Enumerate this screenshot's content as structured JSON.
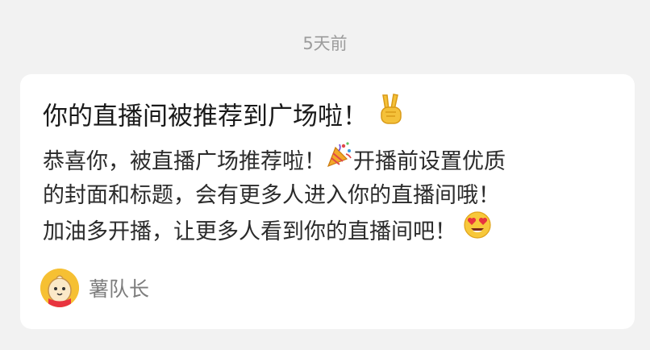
{
  "timestamp": "5天前",
  "card": {
    "title": "你的直播间被推荐到广场啦！",
    "title_emoji": "victory-hand-icon",
    "body": {
      "line1_a": "恭喜你，被直播广场推荐啦！",
      "line1_emoji": "party-popper-icon",
      "line1_b": "开播前设置优质",
      "line2": "的封面和标题，会有更多人进入你的直播间哦！",
      "line3_a": "加油多开播，让更多人看到你的直播间吧！",
      "line3_emoji": "heart-eyes-icon"
    },
    "author": {
      "name": "薯队长",
      "avatar_icon": "potato-mascot-avatar"
    }
  },
  "colors": {
    "background": "#f2f2f2",
    "card": "#ffffff",
    "timestamp": "#9c9c9c",
    "title": "#1a1a1a",
    "body": "#2b2b2b",
    "author": "#7d7d7d"
  }
}
